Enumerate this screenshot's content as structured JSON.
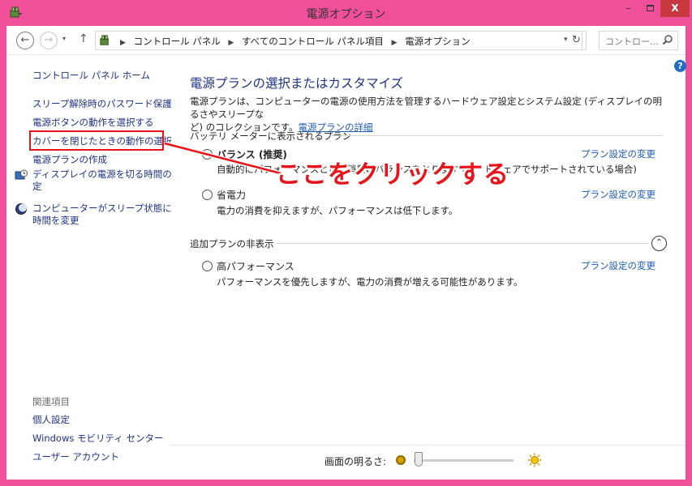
{
  "window": {
    "title": "電源オプション",
    "minimize": "–",
    "close": "X"
  },
  "nav": {
    "back": "←",
    "forward": "→",
    "up": "↑",
    "dropdown": "▾",
    "refresh": "↻",
    "breadcrumbs": [
      "コントロール パネル",
      "すべてのコントロール パネル項目",
      "電源オプション"
    ],
    "search_placeholder": "コントロー..."
  },
  "left_panel": {
    "home": "コントロール パネル ホーム",
    "items": [
      "スリープ解除時のパスワード保護",
      "電源ボタンの動作を選択する",
      "カバーを閉じたときの動作の選択",
      "電源プランの作成",
      "ディスプレイの電源を切る時間の指定",
      "コンピューターがスリープ状態になる時間を変更"
    ],
    "item4_line1": "ディスプレイの電源を切る時間の指",
    "item4_line2": "定",
    "item5_line1": "コンピューターがスリープ状態になる",
    "item5_line2": "時間を変更",
    "related_heading": "関連項目",
    "related": [
      "個人設定",
      "Windows モビリティ センター",
      "ユーザー アカウント"
    ]
  },
  "main": {
    "title": "電源プランの選択またはカスタマイズ",
    "desc_line1": "電源プランは、コンピューターの電源の使用方法を管理するハードウェア設定とシステム設定 (ディスプレイの明るさやスリープな",
    "desc_line2": "ど) のコレクションです。",
    "desc_link": "電源プランの詳細",
    "battery_group": "バッテリ メーターに表示されるプラン",
    "extra_group": "追加プランの非表示",
    "plans": [
      {
        "name": "バランス (推奨)",
        "desc": "自動的にパフォーマンスと電力消費のバランスをとります (ハードウェアでサポートされている場合)",
        "link": "プラン設定の変更",
        "selected": true
      },
      {
        "name": "省電力",
        "desc": "電力の消費を抑えますが、パフォーマンスは低下します。",
        "link": "プラン設定の変更",
        "selected": false
      },
      {
        "name": "高パフォーマンス",
        "desc": "パフォーマンスを優先しますが、電力の消費が増える可能性があります。",
        "link": "プラン設定の変更",
        "selected": false
      }
    ],
    "collapse": "⌃",
    "help": "?"
  },
  "brightness": {
    "label": "画面の明るさ:",
    "level": 0
  },
  "annotation": {
    "text": "ここをクリックする",
    "color": "#e8141c"
  },
  "colors": {
    "frame": "#f0509a",
    "link": "#1e3287",
    "close_button": "#c7383f"
  }
}
